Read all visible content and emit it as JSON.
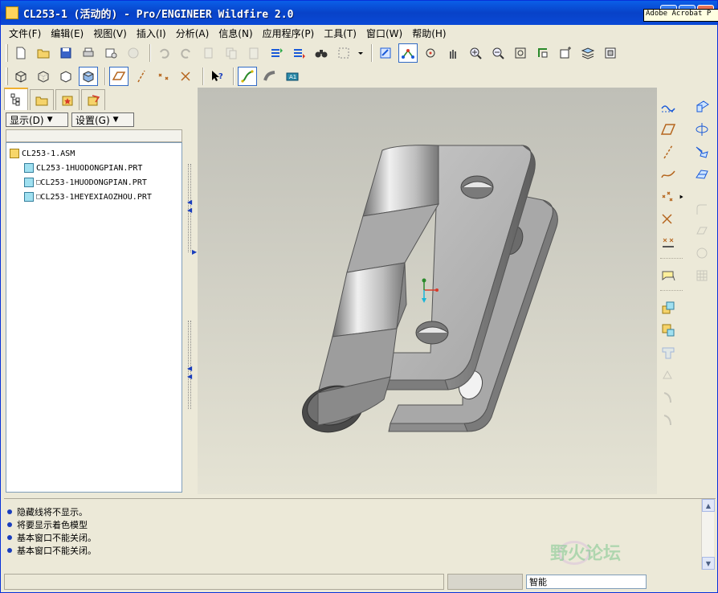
{
  "window": {
    "title": "CL253-1 (活动的) - Pro/ENGINEER Wildfire 2.0",
    "minimize": "_",
    "maximize": "□",
    "close": "✕"
  },
  "menu": [
    "文件(F)",
    "编辑(E)",
    "视图(V)",
    "插入(I)",
    "分析(A)",
    "信息(N)",
    "应用程序(P)",
    "工具(T)",
    "窗口(W)",
    "帮助(H)"
  ],
  "left_panel": {
    "show_dropdown": "显示(D)",
    "settings_dropdown": "设置(G)",
    "tree": {
      "root": "CL253-1.ASM",
      "children": [
        {
          "prefix": "",
          "label": "CL253-1HUODONGPIAN.PRT"
        },
        {
          "prefix": "□",
          "label": "CL253-1HUODONGPIAN.PRT"
        },
        {
          "prefix": "□",
          "label": "CL253-1HEYEXIAOZHOU.PRT"
        }
      ]
    }
  },
  "messages": [
    "隐藏线将不显示。",
    "将要显示着色模型",
    "基本窗口不能关闭。",
    "基本窗口不能关闭。"
  ],
  "watermark": "野火论坛",
  "status": {
    "smart_filter": "智能",
    "tooltip": "Adobe Acrobat P"
  },
  "colors": {
    "titlebar": "#0a5fe8",
    "viewport_top": "#bfbfb7",
    "viewport_bottom": "#e5e3d4"
  }
}
